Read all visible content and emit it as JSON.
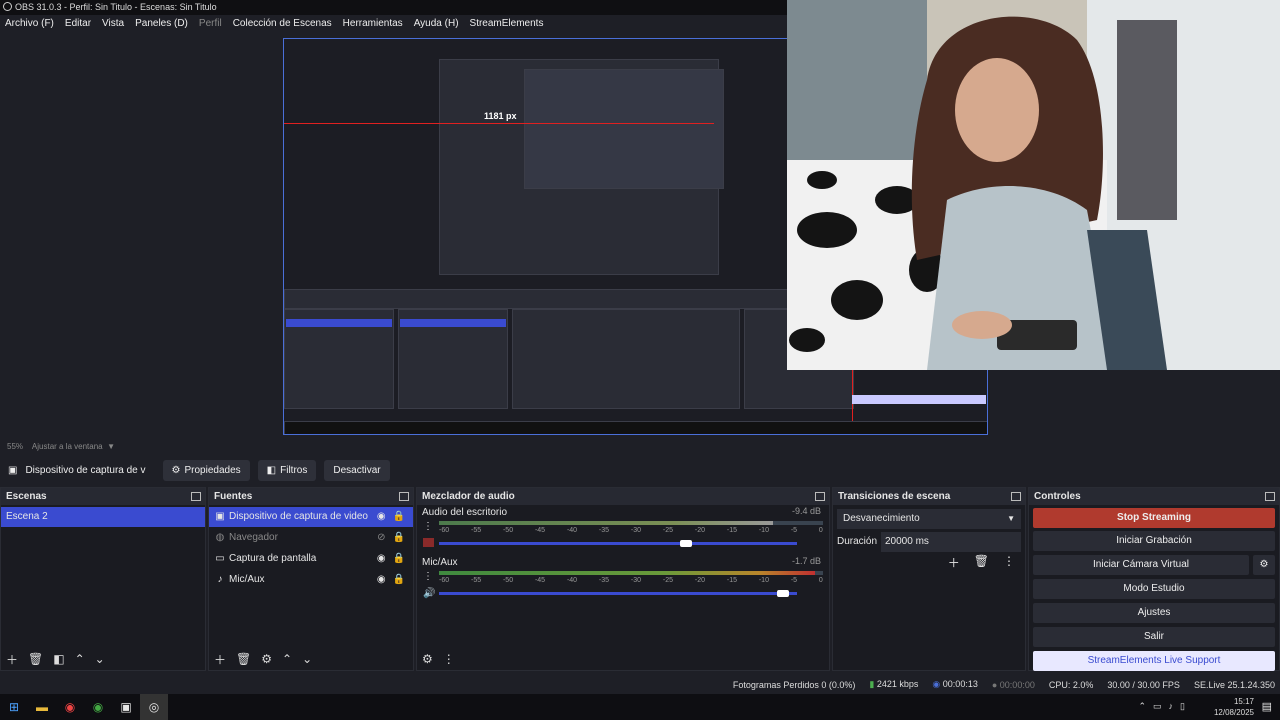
{
  "window": {
    "title": "OBS 31.0.3 - Perfil: Sin Titulo - Escenas: Sin Titulo"
  },
  "menu": [
    "Archivo (F)",
    "Editar",
    "Vista",
    "Paneles (D)",
    "Perfil",
    "Colección de Escenas",
    "Herramientas",
    "Ayuda (H)",
    "StreamElements"
  ],
  "preview": {
    "zoom": "55%",
    "fit": "Ajustar a la ventana",
    "measure": "1181 px"
  },
  "source_toolbar": {
    "source": "Dispositivo de captura de v",
    "properties": "Propiedades",
    "filters": "Filtros",
    "deactivate": "Desactivar"
  },
  "scenes": {
    "title": "Escenas",
    "items": [
      "Escena 2"
    ]
  },
  "sources": {
    "title": "Fuentes",
    "items": [
      "Dispositivo de captura de video",
      "Navegador",
      "Captura de pantalla",
      "Mic/Aux"
    ]
  },
  "mixer": {
    "title": "Mezclador de audio",
    "ticks": [
      "-60",
      "-55",
      "-50",
      "-45",
      "-40",
      "-35",
      "-30",
      "-25",
      "-20",
      "-15",
      "-10",
      "-5",
      "0"
    ],
    "channels": [
      {
        "name": "Audio del escritorio",
        "db": "-9.4 dB",
        "level": 0.87
      },
      {
        "name": "Mic/Aux",
        "db": "-1.7 dB",
        "level": 0.98
      }
    ]
  },
  "transitions": {
    "title": "Transiciones de escena",
    "selected": "Desvanecimiento",
    "duration_label": "Duración",
    "duration": "20000 ms"
  },
  "controls": {
    "title": "Controles",
    "stop_streaming": "Stop Streaming",
    "start_recording": "Iniciar Grabación",
    "start_virtual_cam": "Iniciar Cámara Virtual",
    "studio_mode": "Modo Estudio",
    "settings": "Ajustes",
    "exit": "Salir",
    "support": "StreamElements Live Support"
  },
  "status": {
    "dropped": "Fotogramas Perdidos 0 (0.0%)",
    "kbps": "2421 kbps",
    "stream_time": "00:00:13",
    "rec_time": "00:00:00",
    "cpu": "CPU: 2.0%",
    "fps": "30.00 / 30.00 FPS",
    "version": "SE.Live 25.1.24.350"
  },
  "taskbar": {
    "time": "15:17",
    "date": "12/08/2025"
  },
  "colors": {
    "accent": "#3a4bd0",
    "stop": "#b03a2e",
    "bg": "#1e1f26"
  }
}
